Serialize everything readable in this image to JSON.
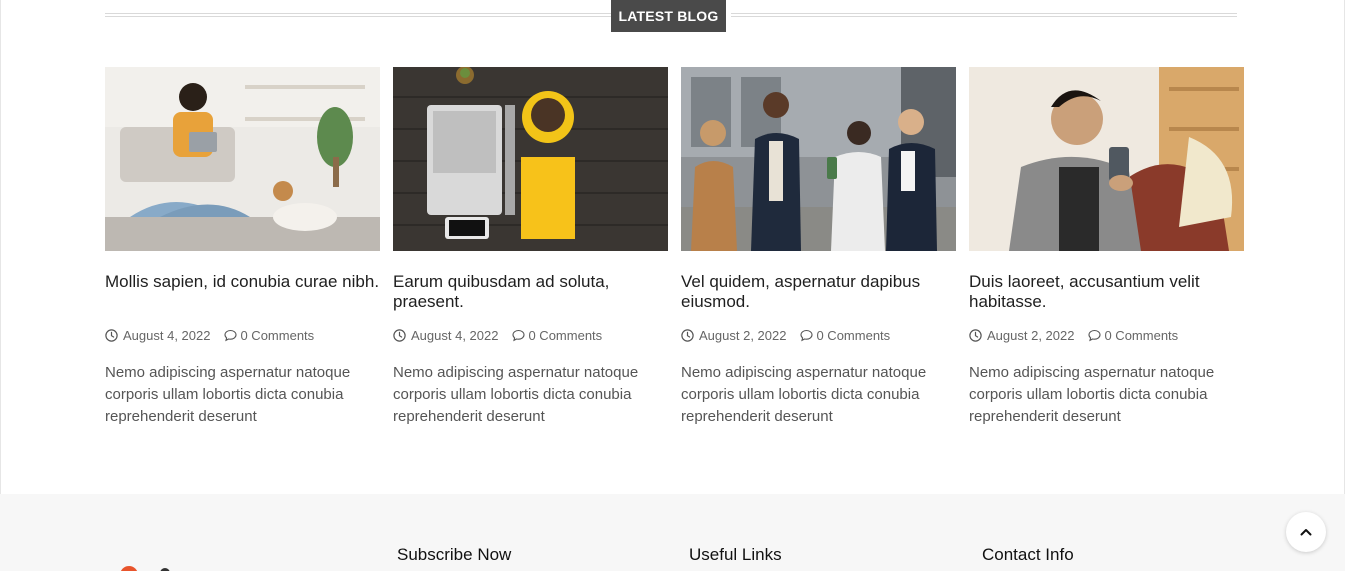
{
  "section": {
    "title": "LATEST BLOG"
  },
  "posts": [
    {
      "title": "Mollis sapien, id conubia curae nibh.",
      "date": "August 4, 2022",
      "comments": "0 Comments",
      "excerpt": "Nemo adipiscing aspernatur natoque corporis ullam lobortis dicta conubia reprehenderit deserunt",
      "image": "woman-with-tablet-and-dog"
    },
    {
      "title": "Earum quibusdam ad soluta, praesent.",
      "date": "August 4, 2022",
      "comments": "0 Comments",
      "excerpt": "Nemo adipiscing aspernatur natoque corporis ullam lobortis dicta conubia reprehenderit deserunt",
      "image": "laptop-coffee-notebook-flatlay"
    },
    {
      "title": "Vel quidem, aspernatur dapibus eiusmod.",
      "date": "August 2, 2022",
      "comments": "0 Comments",
      "excerpt": "Nemo adipiscing aspernatur natoque corporis ullam lobortis dicta conubia reprehenderit deserunt",
      "image": "group-of-friends-outdoors"
    },
    {
      "title": "Duis laoreet, accusantium velit habitasse.",
      "date": "August 2, 2022",
      "comments": "0 Comments",
      "excerpt": "Nemo adipiscing aspernatur natoque corporis ullam lobortis dicta conubia reprehenderit deserunt",
      "image": "man-with-phone-on-sofa"
    }
  ],
  "footer": {
    "columns": [
      "Subscribe Now",
      "Useful Links",
      "Contact Info"
    ]
  },
  "icons": {
    "clock": "clock-icon",
    "comment": "comment-icon",
    "scroll_top": "chevron-up-icon"
  },
  "colors": {
    "header_bg": "#4a4a4a",
    "footer_bg": "#f7f7f7",
    "text_muted": "#666666"
  }
}
